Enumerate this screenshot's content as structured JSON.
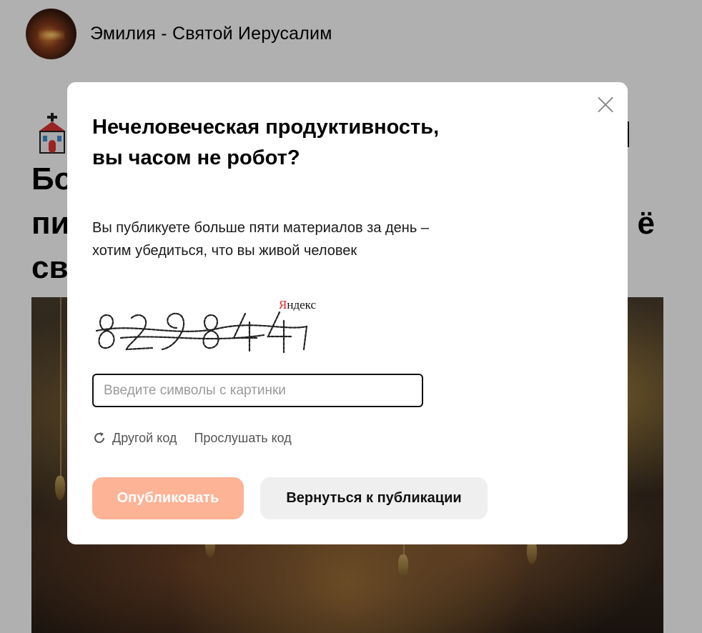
{
  "background_page": {
    "author_name": "Эмилия - Святой Иерусалим",
    "title_visible_fragments": [
      "Бо",
      "пи",
      "св"
    ],
    "title_right_fragment": "ё"
  },
  "modal": {
    "title": "Нечеловеческая продуктивность, вы часом не робот?",
    "description": "Вы публикуете больше пяти материалов за день – хотим убедиться, что вы живой человек",
    "captcha": {
      "code_image_text": "829844",
      "brand_first_letter": "Я",
      "brand_rest": "ндекс"
    },
    "input": {
      "placeholder": "Введите символы с картинки",
      "value": ""
    },
    "links": {
      "other_code": "Другой код",
      "listen_code": "Прослушать код"
    },
    "buttons": {
      "publish": "Опубликовать",
      "back": "Вернуться к публикации"
    },
    "icons": {
      "close": "close-icon",
      "refresh": "refresh-icon"
    },
    "colors": {
      "publish_button_bg": "#fdb395",
      "secondary_button_bg": "#efefef",
      "brand_red": "#e0241b"
    }
  }
}
